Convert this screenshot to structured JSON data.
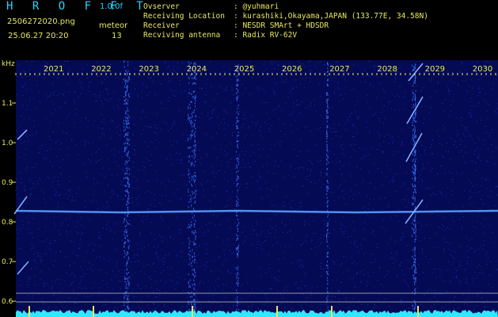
{
  "header": {
    "title": "H R O F F T",
    "version": "1.0.0f",
    "filename": "2506272020.png",
    "mode": "meteor",
    "datetime": "25.06.27 20:20",
    "count": "13",
    "info": [
      {
        "key": "Ovserver",
        "value": ": @yuhmari"
      },
      {
        "key": "Receiving Location",
        "value": ": kurashiki,Okayama,JAPAN (133.77E, 34.58N)"
      },
      {
        "key": "Receiver",
        "value": ": NESDR SMArt + HDSDR"
      },
      {
        "key": "Recviving antenna",
        "value": ": Radix RV-62V"
      }
    ]
  },
  "spectrogram": {
    "y_unit": "kHz",
    "y_ticks": [
      "1.1",
      "1.0",
      "0.9",
      "0.8",
      "0.7",
      "0.6"
    ],
    "time_ticks": [
      "2021",
      "2022",
      "2023",
      "2024",
      "2025",
      "2026",
      "2027",
      "2028",
      "2029",
      "2030"
    ],
    "colors": {
      "background": "#050a55",
      "noise": "#2a55ff",
      "carrier": "#5aa0ff",
      "tick_label": "#e8e860",
      "baseline": "#30e8ff"
    }
  }
}
